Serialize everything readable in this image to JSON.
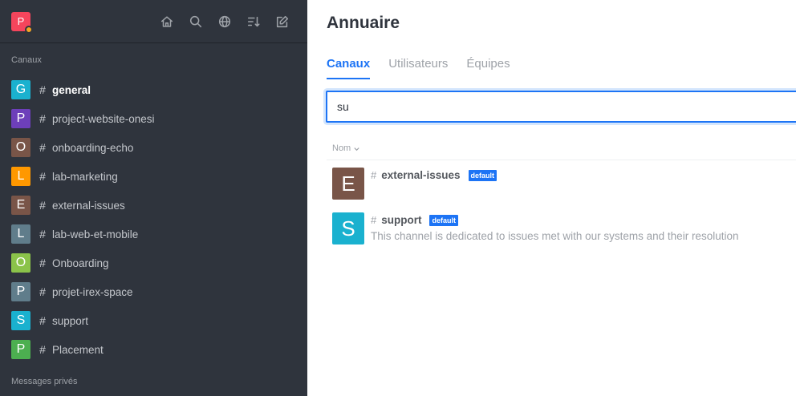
{
  "sidebar": {
    "user_initial": "P",
    "section_channels": "Canaux",
    "section_dm": "Messages privés",
    "rooms": [
      {
        "initial": "G",
        "name": "general",
        "color": "#1ab1cf",
        "active": true
      },
      {
        "initial": "P",
        "name": "project-website-onesi",
        "color": "#6d3fba"
      },
      {
        "initial": "O",
        "name": "onboarding-echo",
        "color": "#795548"
      },
      {
        "initial": "L",
        "name": "lab-marketing",
        "color": "#ff9800"
      },
      {
        "initial": "E",
        "name": "external-issues",
        "color": "#795548"
      },
      {
        "initial": "L",
        "name": "lab-web-et-mobile",
        "color": "#607d8b"
      },
      {
        "initial": "O",
        "name": "Onboarding",
        "color": "#8bc34a"
      },
      {
        "initial": "P",
        "name": "projet-irex-space",
        "color": "#607d8b"
      },
      {
        "initial": "S",
        "name": "support",
        "color": "#1ab1cf"
      },
      {
        "initial": "P",
        "name": "Placement",
        "color": "#4caf50"
      }
    ]
  },
  "main": {
    "title": "Annuaire",
    "tabs": [
      "Canaux",
      "Utilisateurs",
      "Équipes"
    ],
    "search_value": "su",
    "column_name": "Nom",
    "results": [
      {
        "initial": "E",
        "name": "external-issues",
        "badge": "default",
        "description": "",
        "color": "#795548"
      },
      {
        "initial": "S",
        "name": "support",
        "badge": "default",
        "description": "This channel is dedicated to issues met with our systems and their resolution",
        "color": "#1ab1cf"
      }
    ]
  }
}
